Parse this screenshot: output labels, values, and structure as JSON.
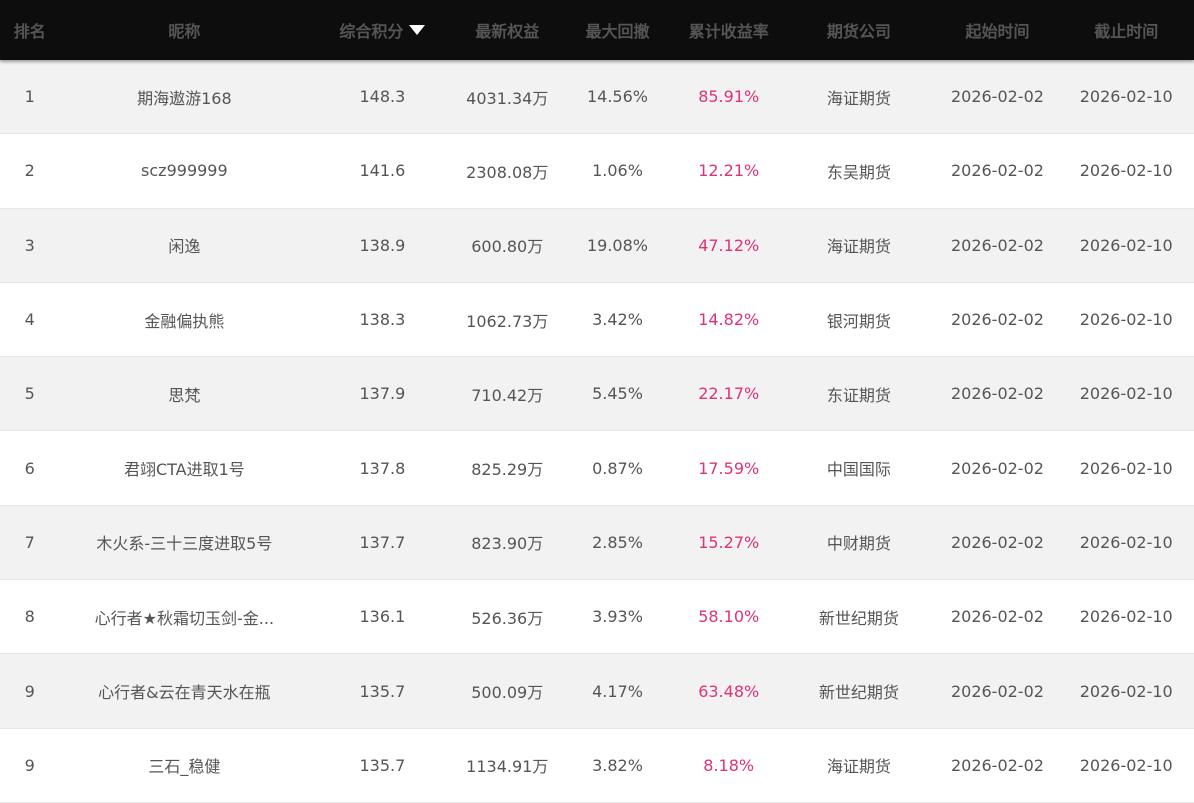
{
  "header": {
    "rank": "排名",
    "nickname": "昵称",
    "score": "综合积分",
    "equity": "最新权益",
    "drawdown": "最大回撤",
    "return": "累计收益率",
    "company": "期货公司",
    "start": "起始时间",
    "end": "截止时间",
    "sort_icon": "triangle-down-icon"
  },
  "colors": {
    "return": "#e0317a",
    "header_bg": "#0d0d0d"
  },
  "rows": [
    {
      "rank": "1",
      "name": "期海遨游168",
      "score": "148.3",
      "equity": "4031.34万",
      "drawdown": "14.56%",
      "return": "85.91%",
      "company": "海证期货",
      "start": "2026-02-02",
      "end": "2026-02-10"
    },
    {
      "rank": "2",
      "name": "scz999999",
      "score": "141.6",
      "equity": "2308.08万",
      "drawdown": "1.06%",
      "return": "12.21%",
      "company": "东吴期货",
      "start": "2026-02-02",
      "end": "2026-02-10"
    },
    {
      "rank": "3",
      "name": "闲逸",
      "score": "138.9",
      "equity": "600.80万",
      "drawdown": "19.08%",
      "return": "47.12%",
      "company": "海证期货",
      "start": "2026-02-02",
      "end": "2026-02-10"
    },
    {
      "rank": "4",
      "name": "金融偏执熊",
      "score": "138.3",
      "equity": "1062.73万",
      "drawdown": "3.42%",
      "return": "14.82%",
      "company": "银河期货",
      "start": "2026-02-02",
      "end": "2026-02-10"
    },
    {
      "rank": "5",
      "name": "思梵",
      "score": "137.9",
      "equity": "710.42万",
      "drawdown": "5.45%",
      "return": "22.17%",
      "company": "东证期货",
      "start": "2026-02-02",
      "end": "2026-02-10"
    },
    {
      "rank": "6",
      "name": "君翊CTA进取1号",
      "score": "137.8",
      "equity": "825.29万",
      "drawdown": "0.87%",
      "return": "17.59%",
      "company": "中国国际",
      "start": "2026-02-02",
      "end": "2026-02-10"
    },
    {
      "rank": "7",
      "name": "木火系-三十三度进取5号",
      "score": "137.7",
      "equity": "823.90万",
      "drawdown": "2.85%",
      "return": "15.27%",
      "company": "中财期货",
      "start": "2026-02-02",
      "end": "2026-02-10"
    },
    {
      "rank": "8",
      "name": "心行者★秋霜切玉剑-金...",
      "score": "136.1",
      "equity": "526.36万",
      "drawdown": "3.93%",
      "return": "58.10%",
      "company": "新世纪期货",
      "start": "2026-02-02",
      "end": "2026-02-10"
    },
    {
      "rank": "9",
      "name": "心行者&云在青天水在瓶",
      "score": "135.7",
      "equity": "500.09万",
      "drawdown": "4.17%",
      "return": "63.48%",
      "company": "新世纪期货",
      "start": "2026-02-02",
      "end": "2026-02-10"
    },
    {
      "rank": "9",
      "name": "三石_稳健",
      "score": "135.7",
      "equity": "1134.91万",
      "drawdown": "3.82%",
      "return": "8.18%",
      "company": "海证期货",
      "start": "2026-02-02",
      "end": "2026-02-10"
    }
  ]
}
